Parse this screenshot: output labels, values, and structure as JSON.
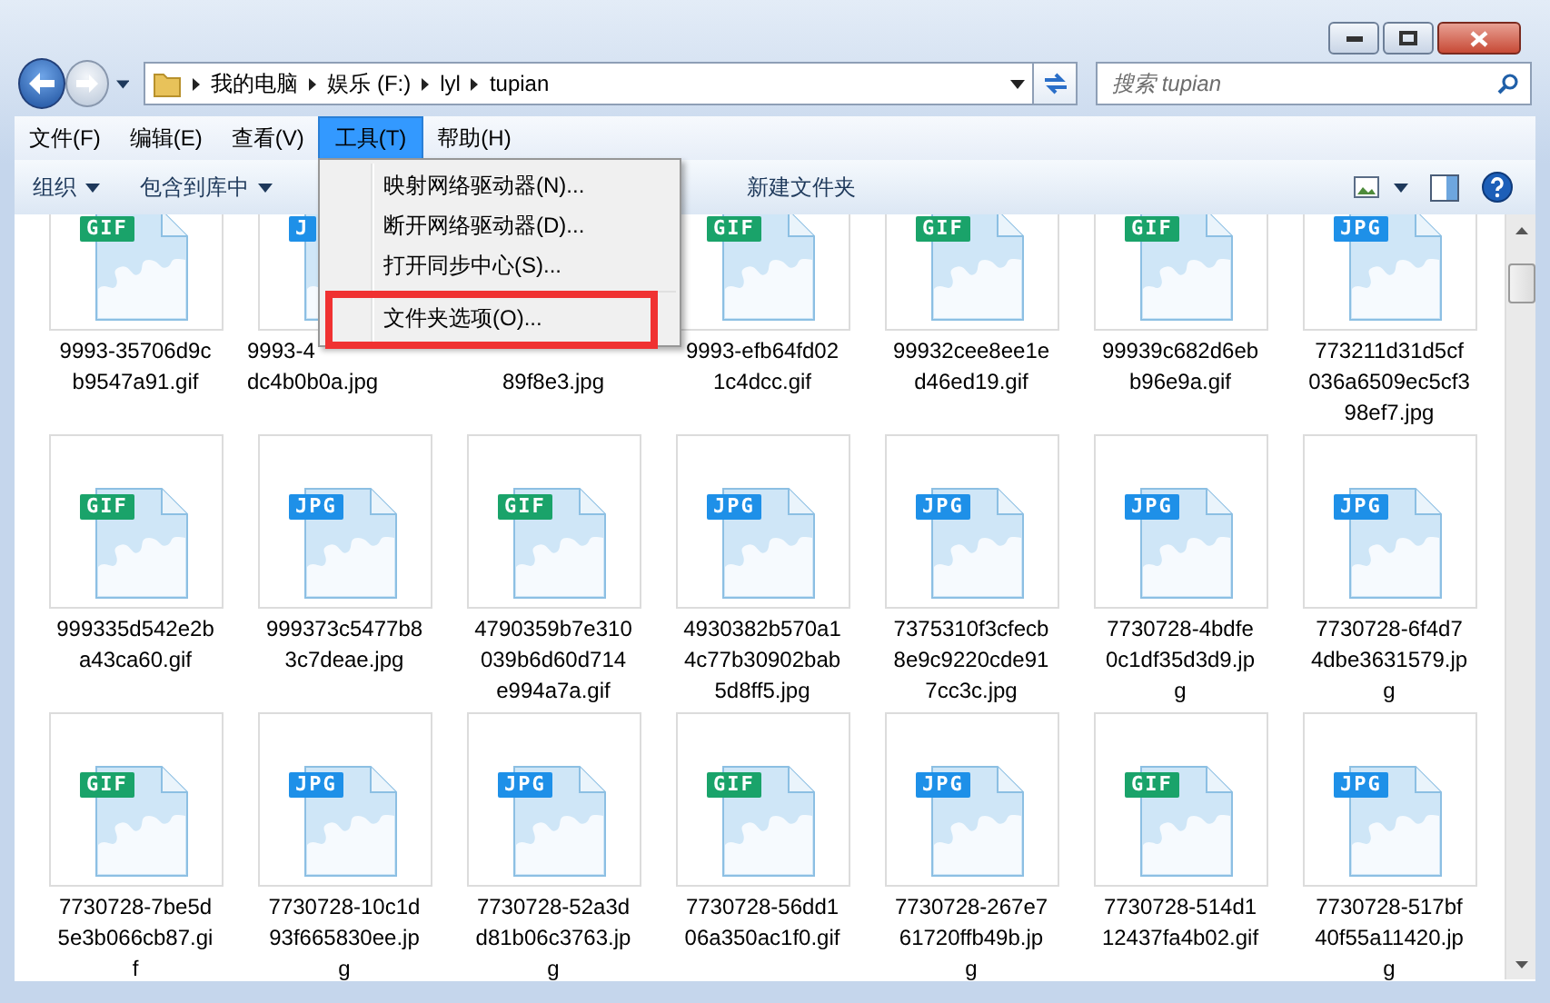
{
  "address": {
    "crumbs": [
      "我的电脑",
      "娱乐 (F:)",
      "lyl",
      "tupian"
    ]
  },
  "search": {
    "placeholder": "搜索 tupian"
  },
  "menu_bar": [
    {
      "label": "文件(F)",
      "selected": false
    },
    {
      "label": "编辑(E)",
      "selected": false
    },
    {
      "label": "查看(V)",
      "selected": false
    },
    {
      "label": "工具(T)",
      "selected": true
    },
    {
      "label": "帮助(H)",
      "selected": false
    }
  ],
  "toolbar": [
    {
      "label": "组织",
      "dropdown": true
    },
    {
      "label": "包含到库中",
      "dropdown": true
    },
    {
      "label": "新建文件夹",
      "dropdown": false
    }
  ],
  "open_menu": [
    {
      "kind": "item",
      "label": "映射网络驱动器(N)...",
      "boxed": false
    },
    {
      "kind": "item",
      "label": "断开网络驱动器(D)...",
      "boxed": false
    },
    {
      "kind": "item",
      "label": "打开同步中心(S)...",
      "boxed": false
    },
    {
      "kind": "separator"
    },
    {
      "kind": "item",
      "label": "文件夹选项(O)...",
      "boxed": true
    }
  ],
  "files": [
    {
      "badge": "GIF",
      "color": "#1aa36a",
      "first_line_covered": false,
      "cut": false,
      "lines": [
        "9993-35706d9c",
        "b9547a91.gif"
      ]
    },
    {
      "badge": "J",
      "color": "#1e90e8",
      "first_line_covered": false,
      "cut": true,
      "lines": [
        "9993-4",
        "dc4b0b0a.jpg"
      ]
    },
    {
      "first_line_covered": true,
      "cut": false,
      "lines": [
        "89f8e3.jpg"
      ]
    },
    {
      "badge": "GIF",
      "color": "#1aa36a",
      "first_line_covered": false,
      "cut": false,
      "lines": [
        "9993-efb64fd02",
        "1c4dcc.gif"
      ]
    },
    {
      "badge": "GIF",
      "color": "#1aa36a",
      "first_line_covered": false,
      "cut": false,
      "lines": [
        "99932cee8ee1e",
        "d46ed19.gif"
      ]
    },
    {
      "badge": "GIF",
      "color": "#1aa36a",
      "first_line_covered": false,
      "cut": false,
      "lines": [
        "99939c682d6eb",
        "b96e9a.gif"
      ]
    },
    {
      "badge": "JPG",
      "color": "#1e90e8",
      "first_line_covered": false,
      "cut": false,
      "lines": [
        "773211d31d5cf",
        "036a6509ec5cf3",
        "98ef7.jpg"
      ]
    },
    {
      "badge": "GIF",
      "color": "#1aa36a",
      "first_line_covered": false,
      "cut": false,
      "lines": [
        "999335d542e2b",
        "a43ca60.gif"
      ]
    },
    {
      "badge": "JPG",
      "color": "#1e90e8",
      "first_line_covered": false,
      "cut": false,
      "lines": [
        "999373c5477b8",
        "3c7deae.jpg"
      ]
    },
    {
      "badge": "GIF",
      "color": "#1aa36a",
      "first_line_covered": false,
      "cut": false,
      "lines": [
        "4790359b7e310",
        "039b6d60d714",
        "e994a7a.gif"
      ]
    },
    {
      "badge": "JPG",
      "color": "#1e90e8",
      "first_line_covered": false,
      "cut": false,
      "lines": [
        "4930382b570a1",
        "4c77b30902bab",
        "5d8ff5.jpg"
      ]
    },
    {
      "badge": "JPG",
      "color": "#1e90e8",
      "first_line_covered": false,
      "cut": false,
      "lines": [
        "7375310f3cfecb",
        "8e9c9220cde91",
        "7cc3c.jpg"
      ]
    },
    {
      "badge": "JPG",
      "color": "#1e90e8",
      "first_line_covered": false,
      "cut": false,
      "lines": [
        "7730728-4bdfe",
        "0c1df35d3d9.jp",
        "g"
      ]
    },
    {
      "badge": "JPG",
      "color": "#1e90e8",
      "first_line_covered": false,
      "cut": false,
      "lines": [
        "7730728-6f4d7",
        "4dbe3631579.jp",
        "g"
      ]
    },
    {
      "badge": "GIF",
      "color": "#1aa36a",
      "first_line_covered": false,
      "cut": false,
      "lines": [
        "7730728-7be5d",
        "5e3b066cb87.gi",
        "f"
      ]
    },
    {
      "badge": "JPG",
      "color": "#1e90e8",
      "first_line_covered": false,
      "cut": false,
      "lines": [
        "7730728-10c1d",
        "93f665830ee.jp",
        "g"
      ]
    },
    {
      "badge": "JPG",
      "color": "#1e90e8",
      "first_line_covered": false,
      "cut": false,
      "lines": [
        "7730728-52a3d",
        "d81b06c3763.jp",
        "g"
      ]
    },
    {
      "badge": "GIF",
      "color": "#1aa36a",
      "first_line_covered": false,
      "cut": false,
      "lines": [
        "7730728-56dd1",
        "06a350ac1f0.gif"
      ]
    },
    {
      "badge": "JPG",
      "color": "#1e90e8",
      "first_line_covered": false,
      "cut": false,
      "lines": [
        "7730728-267e7",
        "61720ffb49b.jp",
        "g"
      ]
    },
    {
      "badge": "GIF",
      "color": "#1aa36a",
      "first_line_covered": false,
      "cut": false,
      "lines": [
        "7730728-514d1",
        "12437fa4b02.gif"
      ]
    },
    {
      "badge": "JPG",
      "color": "#1e90e8",
      "first_line_covered": false,
      "cut": false,
      "lines": [
        "7730728-517bf",
        "40f55a11420.jp",
        "g"
      ]
    }
  ]
}
